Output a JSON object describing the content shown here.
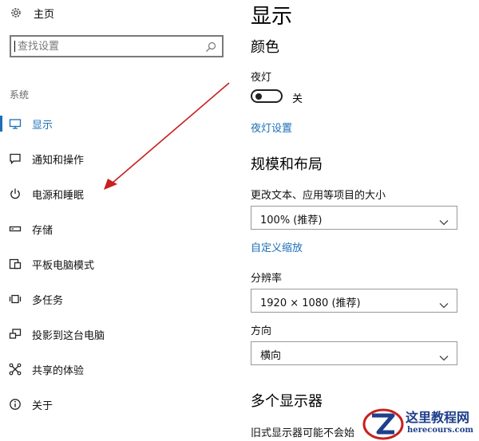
{
  "sidebar": {
    "home_label": "主页",
    "search_placeholder": "查找设置",
    "section_title": "系统",
    "items": [
      {
        "label": "显示",
        "icon": "monitor-icon",
        "active": true
      },
      {
        "label": "通知和操作",
        "icon": "notification-icon"
      },
      {
        "label": "电源和睡眠",
        "icon": "power-icon"
      },
      {
        "label": "存储",
        "icon": "storage-icon"
      },
      {
        "label": "平板电脑模式",
        "icon": "tablet-mode-icon"
      },
      {
        "label": "多任务",
        "icon": "multitasking-icon"
      },
      {
        "label": "投影到这台电脑",
        "icon": "projecting-icon"
      },
      {
        "label": "共享的体验",
        "icon": "shared-experiences-icon"
      },
      {
        "label": "关于",
        "icon": "info-icon"
      }
    ]
  },
  "main": {
    "title": "显示",
    "color_heading": "颜色",
    "night_light_label": "夜灯",
    "night_light_state": "关",
    "night_light_settings_link": "夜灯设置",
    "scale_layout_heading": "规模和布局",
    "text_size_label": "更改文本、应用等项目的大小",
    "scale_value": "100% (推荐)",
    "custom_scaling_link": "自定义缩放",
    "resolution_label": "分辨率",
    "resolution_value": "1920 × 1080 (推荐)",
    "orientation_label": "方向",
    "orientation_value": "横向",
    "multiple_displays_heading": "多个显示器",
    "multiple_displays_text": "旧式显示器可能不会始"
  },
  "watermark": {
    "title": "这里教程网",
    "subtitle": "herecours.com"
  },
  "colors": {
    "accent": "#1a6fb8",
    "annotation_arrow": "#c8201e"
  }
}
